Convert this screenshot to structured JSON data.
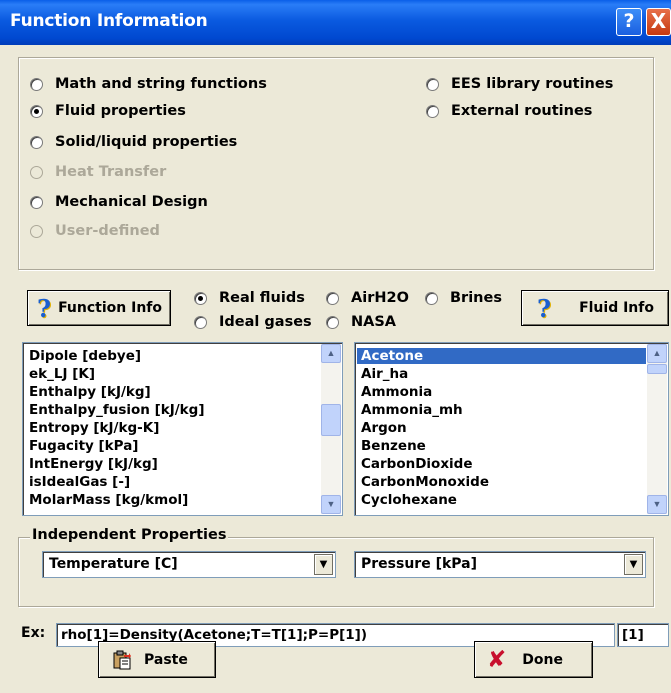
{
  "window": {
    "title": "Function Information",
    "help_glyph": "?",
    "close_glyph": "X"
  },
  "category": {
    "options": [
      {
        "label": "Math and string functions",
        "selected": false,
        "enabled": true
      },
      {
        "label": "Fluid properties",
        "selected": true,
        "enabled": true
      },
      {
        "label": "Solid/liquid properties",
        "selected": false,
        "enabled": true
      },
      {
        "label": "Heat Transfer",
        "selected": false,
        "enabled": false
      },
      {
        "label": "Mechanical Design",
        "selected": false,
        "enabled": true
      },
      {
        "label": "User-defined",
        "selected": false,
        "enabled": false
      },
      {
        "label": "EES library routines",
        "selected": false,
        "enabled": true
      },
      {
        "label": "External routines",
        "selected": false,
        "enabled": true
      }
    ]
  },
  "toolbar": {
    "function_info_label": "Function Info",
    "fluid_info_label": "Fluid Info",
    "fluid_types": [
      {
        "label": "Real fluids",
        "selected": true
      },
      {
        "label": "AirH2O",
        "selected": false
      },
      {
        "label": "Brines",
        "selected": false
      },
      {
        "label": "Ideal gases",
        "selected": false
      },
      {
        "label": "NASA",
        "selected": false
      }
    ]
  },
  "property_list": {
    "items": [
      "Dipole [debye]",
      "ek_LJ [K]",
      "Enthalpy [kJ/kg]",
      "Enthalpy_fusion [kJ/kg]",
      "Entropy [kJ/kg-K]",
      "Fugacity [kPa]",
      "IntEnergy [kJ/kg]",
      "isIdealGas [-]",
      "MolarMass [kg/kmol]"
    ]
  },
  "fluid_list": {
    "items": [
      "Acetone",
      "Air_ha",
      "Ammonia",
      "Ammonia_mh",
      "Argon",
      "Benzene",
      "CarbonDioxide",
      "CarbonMonoxide",
      "Cyclohexane"
    ],
    "selected": "Acetone"
  },
  "independent": {
    "legend": "Independent Properties",
    "first": "Temperature [C]",
    "second": "Pressure [kPa]"
  },
  "example": {
    "label": "Ex:",
    "text": "rho[1]=Density(Acetone;T=T[1];P=P[1])",
    "index": "[1]"
  },
  "actions": {
    "paste_label": "Paste",
    "done_label": "Done"
  },
  "icons": [
    "help-icon",
    "close-icon",
    "question-mark-icon",
    "paste-icon",
    "done-x-icon",
    "scroll-up-icon",
    "scroll-down-icon",
    "dropdown-arrow-icon"
  ]
}
